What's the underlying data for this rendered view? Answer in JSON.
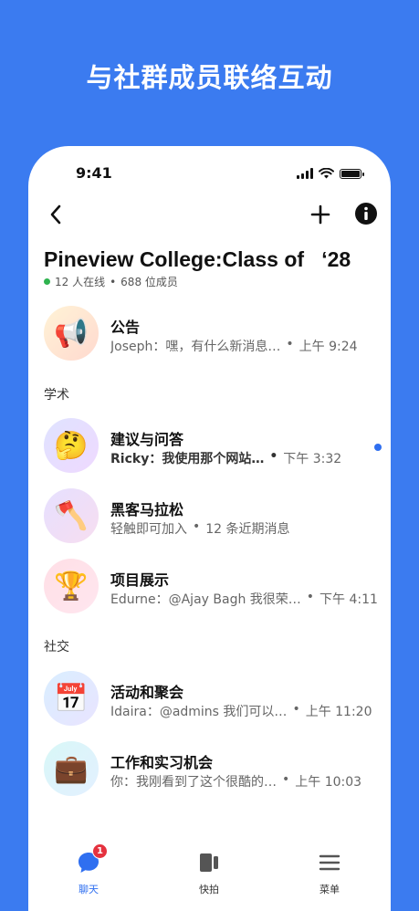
{
  "headline": "与社群成员联络互动",
  "status_bar": {
    "time": "9:41"
  },
  "group": {
    "title": "Pineview College:Class of   ‘28",
    "online": "12 人在线",
    "members": "688 位成员"
  },
  "announcement": {
    "name": "公告",
    "preview": "Joseph：嘿，有什么新消息…",
    "time": "上午 9:24",
    "icon": "megaphone-icon"
  },
  "sections": {
    "academic": "学术",
    "social": "社交"
  },
  "academic_channels": [
    {
      "name": "建议与问答",
      "preview": "Ricky：我使用那个网站…",
      "time": "下午 3:32",
      "unread": true,
      "icon": "thinking-face-icon"
    },
    {
      "name": "黑客马拉松",
      "preview": "轻触即可加入",
      "time": "12 条近期消息",
      "unread": false,
      "icon": "axe-icon"
    },
    {
      "name": "项目展示",
      "preview": "Edurne：@Ajay Bagh 我很荣…",
      "time": "下午 4:11",
      "unread": false,
      "icon": "trophy-icon"
    }
  ],
  "social_channels": [
    {
      "name": "活动和聚会",
      "preview": "Idaira：@admins 我们可以…",
      "time": "上午 11:20",
      "icon": "calendar-icon"
    },
    {
      "name": "工作和实习机会",
      "preview": "你：我刚看到了这个很酷的…",
      "time": "上午 10:03",
      "icon": "briefcase-icon"
    }
  ],
  "tabs": [
    {
      "label": "聊天",
      "badge": "1",
      "active": true
    },
    {
      "label": "快拍"
    },
    {
      "label": "菜单"
    }
  ],
  "colors": {
    "accent": "#2f6ff0",
    "background": "#3b7bf0",
    "badge": "#e5323f",
    "online": "#2fb34f"
  }
}
